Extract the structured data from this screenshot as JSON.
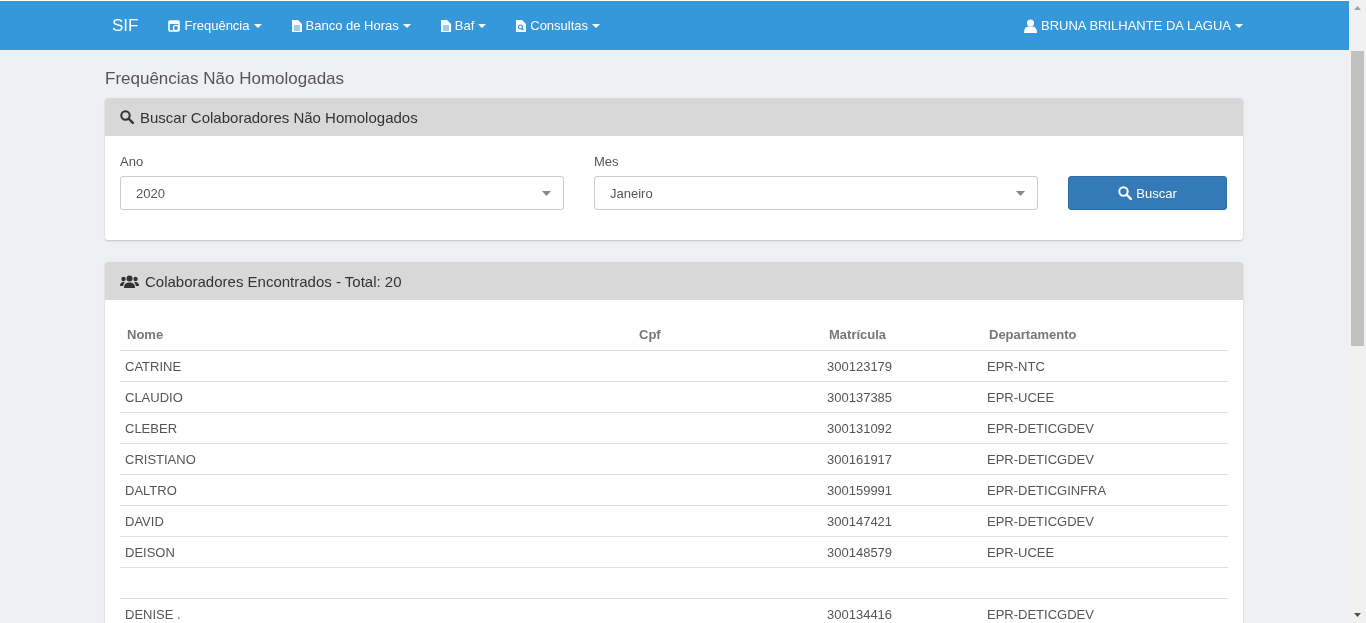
{
  "navbar": {
    "brand": "SIF",
    "menus": [
      {
        "label": "Frequência",
        "kind": "calendar"
      },
      {
        "label": "Banco de Horas",
        "kind": "document"
      },
      {
        "label": "Baf",
        "kind": "document"
      },
      {
        "label": "Consultas",
        "kind": "lookup"
      }
    ],
    "user": "BRUNA BRILHANTE DA LAGUA"
  },
  "page_title": "Frequências Não Homologadas",
  "search_panel": {
    "title": "Buscar Colaboradores Não Homologados",
    "fields": [
      {
        "label": "Ano",
        "value": "2020"
      },
      {
        "label": "Mes",
        "value": "Janeiro"
      }
    ],
    "button": "Buscar"
  },
  "results_panel": {
    "title": "Colaboradores Encontrados - Total: 20",
    "table": {
      "columns": [
        "Nome",
        "Cpf",
        "Matrícula",
        "Departamento"
      ],
      "rows": [
        {
          "kind": "data",
          "cells": [
            "CATRINE",
            "",
            "300123179",
            "EPR-NTC"
          ]
        },
        {
          "kind": "data",
          "cells": [
            "CLAUDIO",
            "",
            "300137385",
            "EPR-UCEE"
          ]
        },
        {
          "kind": "data",
          "cells": [
            "CLEBER",
            "",
            "300131092",
            "EPR-DETICGDEV"
          ]
        },
        {
          "kind": "data",
          "cells": [
            "CRISTIANO",
            "",
            "300161917",
            "EPR-DETICGDEV"
          ]
        },
        {
          "kind": "data",
          "cells": [
            "DALTRO",
            "",
            "300159991",
            "EPR-DETICGINFRA"
          ]
        },
        {
          "kind": "data",
          "cells": [
            "DAVID",
            "",
            "300147421",
            "EPR-DETICGDEV"
          ]
        },
        {
          "kind": "data",
          "cells": [
            "DEISON",
            "",
            "300148579",
            "EPR-UCEE"
          ]
        },
        {
          "kind": "empty"
        },
        {
          "kind": "data",
          "cells": [
            "DENISE .",
            "",
            "300134416",
            "EPR-DETICGDEV"
          ]
        }
      ]
    }
  }
}
